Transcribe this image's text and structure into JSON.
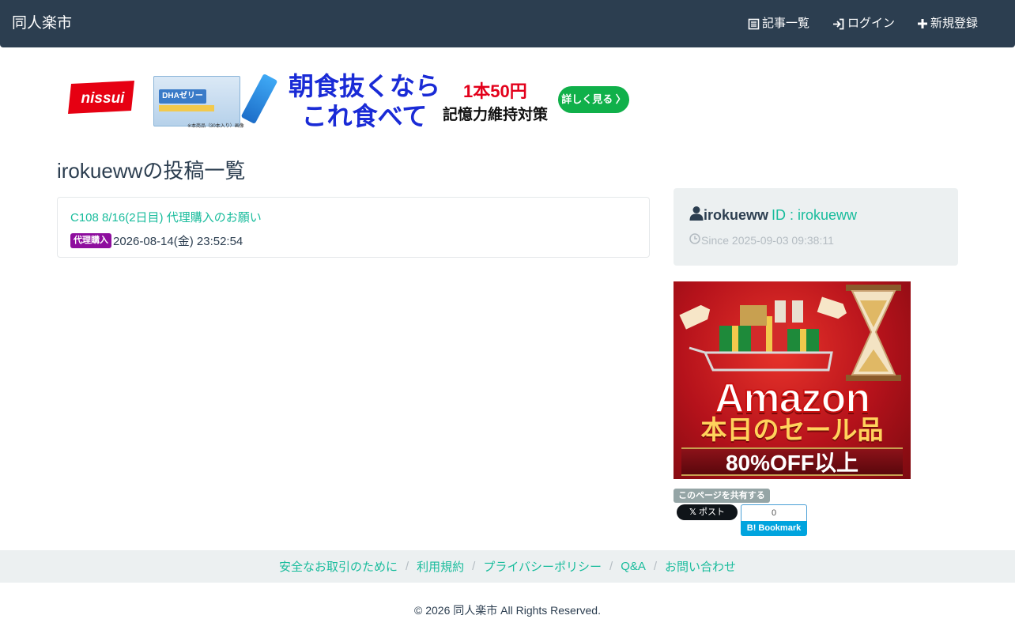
{
  "navbar": {
    "brand": "同人楽市",
    "items": [
      {
        "label": "記事一覧",
        "icon": "list-icon"
      },
      {
        "label": "ログイン",
        "icon": "login-icon"
      },
      {
        "label": "新規登録",
        "icon": "plus-icon"
      }
    ]
  },
  "banner_ad": {
    "brand": "nissui",
    "package_label": "DHAゼリー",
    "package_note": "※本商品（30本入り）画像",
    "headline_1": "朝食抜くなら",
    "headline_2": "これ食べて",
    "price": "1本50円",
    "subcopy": "記憶力維持対策",
    "cta": "詳しく見る 〉"
  },
  "page": {
    "title": "irokuewwの投稿一覧"
  },
  "posts": [
    {
      "title": "C108 8/16(2日目) 代理購入のお願い",
      "badge": "代理購入",
      "date": "2026-08-14(金) 23:52:54"
    }
  ],
  "profile": {
    "username": "irokueww",
    "id_text": "ID : irokueww",
    "since": "Since 2025-09-03 09:38:11"
  },
  "amazon_ad": {
    "title": "Amazon",
    "subtitle": "本日のセール品",
    "offer": "80%OFF以上"
  },
  "share": {
    "label": "このページを共有する",
    "x_post": "ポスト",
    "hatena_count": "0",
    "hatena_label": "B! Bookmark"
  },
  "footer": {
    "links": [
      "安全なお取引のために",
      "利用規約",
      "プライバシーポリシー",
      "Q&A",
      "お問い合わせ"
    ],
    "separator": "/",
    "copyright": "© 2026 同人楽市 All Rights Reserved."
  },
  "colors": {
    "navbar": "#2c3e50",
    "link": "#18bc9c",
    "badge": "#8e0e9e",
    "panel": "#ecf0f1"
  }
}
